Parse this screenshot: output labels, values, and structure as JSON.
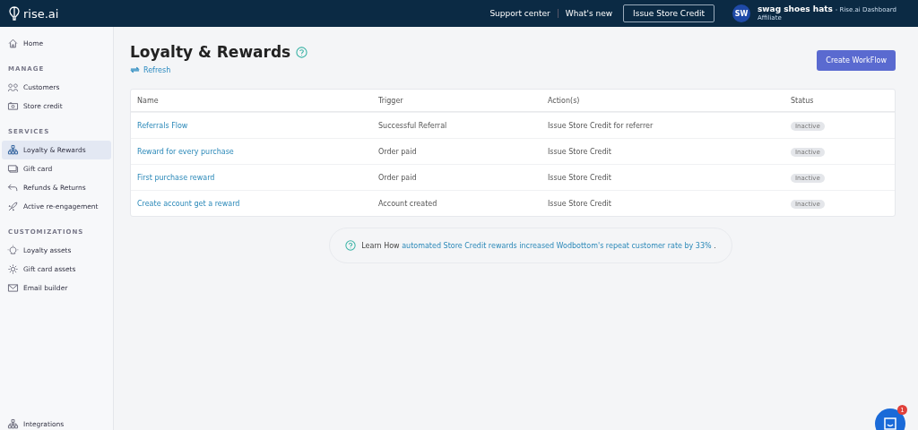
{
  "topbar": {
    "logo": "rise.ai",
    "links": [
      "Support center",
      "What's new"
    ],
    "action_button": "Issue Store Credit",
    "user": {
      "initials": "SW",
      "store": "swag shoes hats",
      "suffix": "- Rise.ai Dashboard",
      "role": "Affiliate"
    }
  },
  "sidebar": {
    "sections": [
      {
        "items": [
          {
            "label": "Home",
            "selected": false
          }
        ]
      },
      {
        "heading": "MANAGE",
        "items": [
          {
            "label": "Customers",
            "selected": false
          },
          {
            "label": "Store credit",
            "selected": false
          }
        ]
      },
      {
        "heading": "SERVICES",
        "items": [
          {
            "label": "Loyalty & Rewards",
            "selected": true
          },
          {
            "label": "Gift card",
            "selected": false
          },
          {
            "label": "Refunds & Returns",
            "selected": false
          },
          {
            "label": "Active re-engagement",
            "selected": false
          }
        ]
      },
      {
        "heading": "CUSTOMIZATIONS",
        "items": [
          {
            "label": "Loyalty assets",
            "selected": false
          },
          {
            "label": "Gift card assets",
            "selected": false
          },
          {
            "label": "Email builder",
            "selected": false
          }
        ]
      }
    ],
    "bottom_item": {
      "label": "Integrations",
      "selected": false
    }
  },
  "page": {
    "title": "Loyalty & Rewards",
    "refresh": "Refresh",
    "create_button": "Create WorkFlow"
  },
  "table": {
    "columns": [
      "Name",
      "Trigger",
      "Action(s)",
      "Status"
    ],
    "rows": [
      {
        "name": "Referrals Flow",
        "trigger": "Successful Referral",
        "action": "Issue Store Credit for referrer",
        "status": "Inactive"
      },
      {
        "name": "Reward for every purchase",
        "trigger": "Order paid",
        "action": "Issue Store Credit",
        "status": "Inactive"
      },
      {
        "name": "First purchase reward",
        "trigger": "Order paid",
        "action": "Issue Store Credit",
        "status": "Inactive"
      },
      {
        "name": "Create account get a reward",
        "trigger": "Account created",
        "action": "Issue Store Credit",
        "status": "Inactive"
      }
    ]
  },
  "tip": {
    "lead": "Learn How",
    "link": "automated Store Credit rewards increased Wodbottom's repeat customer rate by 33%",
    "end": "."
  },
  "chat": {
    "badge": "1"
  }
}
